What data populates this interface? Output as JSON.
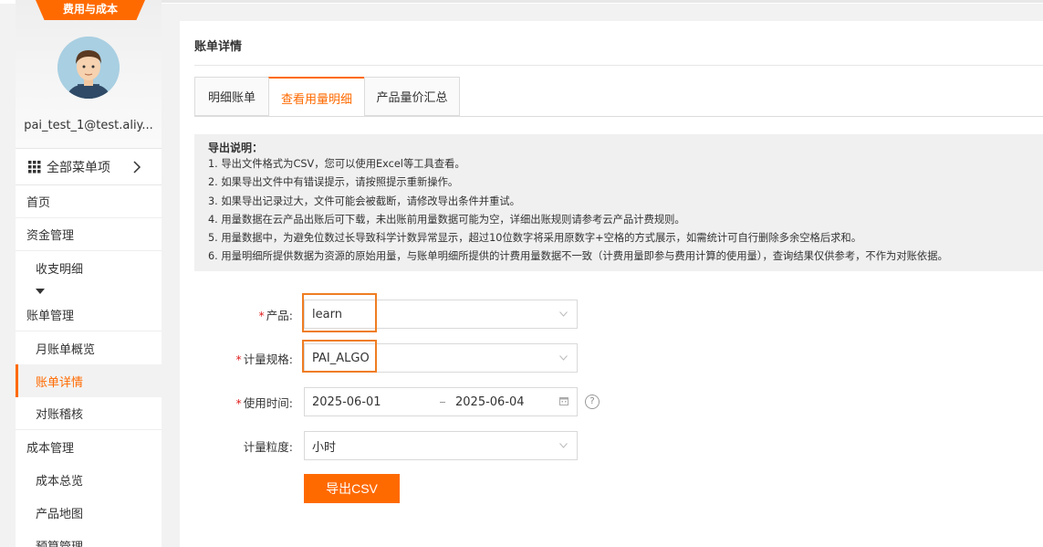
{
  "sidebar": {
    "brand": "费用与成本",
    "account_name": "pai_test_1@test.aliy...",
    "all_menu_label": "全部菜单项",
    "items": [
      {
        "label": "首页",
        "level": 1
      },
      {
        "label": "资金管理",
        "level": 1
      },
      {
        "label": "收支明细",
        "level": 2
      },
      {
        "label": "账单管理",
        "level": 1
      },
      {
        "label": "月账单概览",
        "level": 2
      },
      {
        "label": "账单详情",
        "level": 2,
        "active": true
      },
      {
        "label": "对账稽核",
        "level": 2
      },
      {
        "label": "成本管理",
        "level": 1
      },
      {
        "label": "成本总览",
        "level": 2
      },
      {
        "label": "产品地图",
        "level": 2
      },
      {
        "label": "预算管理",
        "level": 2
      }
    ]
  },
  "main": {
    "title": "账单详情",
    "tabs": [
      {
        "label": "明细账单",
        "active": false
      },
      {
        "label": "查看用量明细",
        "active": true
      },
      {
        "label": "产品量价汇总",
        "active": false
      }
    ],
    "notice": {
      "title": "导出说明：",
      "lines": [
        "1. 导出文件格式为CSV，您可以使用Excel等工具查看。",
        "2. 如果导出文件中有错误提示，请按照提示重新操作。",
        "3. 如果导出记录过大，文件可能会被截断，请修改导出条件并重试。",
        "4. 用量数据在云产品出账后可下载，未出账前用量数据可能为空，详细出账规则请参考云产品计费规则。",
        "5. 用量数据中，为避免位数过长导致科学计数异常显示，超过10位数字将采用原数字+空格的方式展示，如需统计可自行删除多余空格后求和。",
        "6. 用量明细所提供数据为资源的原始用量，与账单明细所提供的计费用量数据不一致（计费用量即参与费用计算的使用量），查询结果仅供参考，不作为对账依据。"
      ]
    },
    "form": {
      "product_label": "产品:",
      "product_value": "learn",
      "spec_label": "计量规格:",
      "spec_value": "PAI_ALGO",
      "time_label": "使用时间:",
      "date_start": "2025-06-01",
      "date_end": "2025-06-04",
      "granularity_label": "计量粒度:",
      "granularity_value": "小时",
      "required_mark": "*",
      "help_mark": "?",
      "export_label": "导出CSV"
    }
  },
  "colors": {
    "accent": "#ff6a00",
    "highlight_box": "#ef7d22",
    "required": "#e02020"
  }
}
